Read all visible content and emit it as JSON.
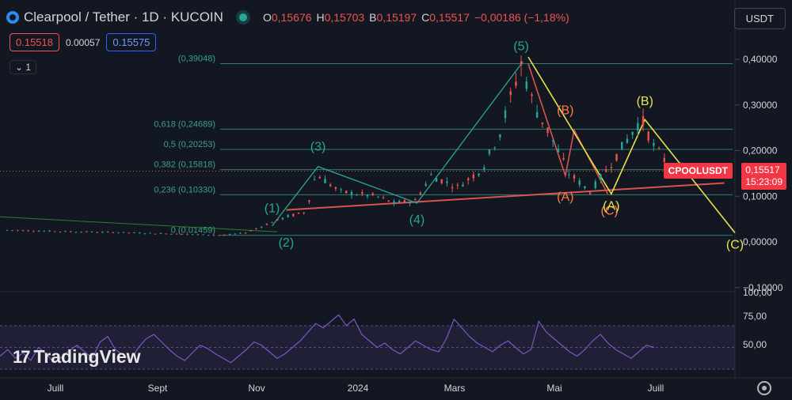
{
  "header": {
    "symbol": "Clearpool / Tether · 1D · KUCOIN",
    "ohlc": [
      {
        "k": "O",
        "v": "0,15676"
      },
      {
        "k": "H",
        "v": "0,15703"
      },
      {
        "k": "B",
        "v": "0,15197"
      },
      {
        "k": "C",
        "v": "0,15517"
      },
      {
        "k": "",
        "v": "−0,00186 (−1,18%)"
      }
    ],
    "sell_price": "0.15518",
    "spread": "0.00057",
    "buy_price": "0.15575",
    "collapse_label": "1",
    "currency": "USDT"
  },
  "watermark": "TradingView",
  "last_price": {
    "symbol": "CPOOLUSDT",
    "price": "0,15517",
    "countdown": "15:23:09"
  },
  "colors": {
    "up": "#26a69a",
    "down": "#ef5350",
    "teal": "#26a69a",
    "orange": "#ff7a45",
    "yellow": "#e8e34a",
    "rsi": "#7e57c2"
  },
  "chart_data": {
    "type": "candlestick",
    "x_ticks": [
      "Juill",
      "Sept",
      "Nov",
      "2024",
      "Mars",
      "Mai",
      "Juill"
    ],
    "y_ticks": [
      "0,40000",
      "0,30000",
      "0,20000",
      "0,10000",
      "0,00000",
      "−0,10000"
    ],
    "ylim": [
      -0.1,
      0.42
    ],
    "price_path": [
      [
        "2023-06-15",
        0.026
      ],
      [
        "2023-07-15",
        0.023
      ],
      [
        "2023-08-15",
        0.021
      ],
      [
        "2023-09-15",
        0.018
      ],
      [
        "2023-10-15",
        0.0146
      ],
      [
        "2023-10-28",
        0.02
      ],
      [
        "2023-11-10",
        0.04
      ],
      [
        "2023-11-20",
        0.055
      ],
      [
        "2023-12-01",
        0.065
      ],
      [
        "2023-12-07",
        0.15
      ],
      [
        "2023-12-20",
        0.11
      ],
      [
        "2024-01-10",
        0.1
      ],
      [
        "2024-01-20",
        0.085
      ],
      [
        "2024-02-01",
        0.09
      ],
      [
        "2024-02-10",
        0.145
      ],
      [
        "2024-02-25",
        0.12
      ],
      [
        "2024-03-10",
        0.16
      ],
      [
        "2024-03-20",
        0.24
      ],
      [
        "2024-04-01",
        0.39
      ],
      [
        "2024-04-08",
        0.3
      ],
      [
        "2024-04-18",
        0.23
      ],
      [
        "2024-04-28",
        0.15
      ],
      [
        "2024-05-10",
        0.11
      ],
      [
        "2024-05-20",
        0.16
      ],
      [
        "2024-06-01",
        0.23
      ],
      [
        "2024-06-08",
        0.27
      ],
      [
        "2024-06-15",
        0.21
      ],
      [
        "2024-06-25",
        0.16
      ],
      [
        "2024-07-05",
        0.155
      ]
    ],
    "fib_levels": [
      {
        "ratio": "",
        "value": 0.39048,
        "label": "(0,39048)"
      },
      {
        "ratio": "0,618",
        "value": 0.24689,
        "label": "(0,24689)"
      },
      {
        "ratio": "0,5",
        "value": 0.20253,
        "label": "(0,20253)"
      },
      {
        "ratio": "0,382",
        "value": 0.15818,
        "label": "(0,15818)"
      },
      {
        "ratio": "0,236",
        "value": 0.1033,
        "label": "(0,10330)"
      },
      {
        "ratio": "0",
        "value": 0.01459,
        "label": "(0,01459)"
      }
    ],
    "wave_labels": [
      {
        "text": "(1)",
        "date": "2023-11-12",
        "y": 0.065,
        "color": "teal"
      },
      {
        "text": "(2)",
        "date": "2023-11-20",
        "y": -0.01,
        "color": "teal"
      },
      {
        "text": "(3)",
        "date": "2023-12-08",
        "y": 0.2,
        "color": "teal"
      },
      {
        "text": "(4)",
        "date": "2024-02-02",
        "y": 0.04,
        "color": "teal"
      },
      {
        "text": "(5)",
        "date": "2024-04-01",
        "y": 0.42,
        "color": "teal"
      },
      {
        "text": "(B)",
        "date": "2024-04-26",
        "y": 0.28,
        "color": "orange"
      },
      {
        "text": "(A)",
        "date": "2024-04-26",
        "y": 0.09,
        "color": "orange"
      },
      {
        "text": "(C)",
        "date": "2024-05-21",
        "y": 0.06,
        "color": "orange"
      },
      {
        "text": "(A)",
        "date": "2024-05-22",
        "y": 0.07,
        "color": "yellow"
      },
      {
        "text": "(B)",
        "date": "2024-06-10",
        "y": 0.3,
        "color": "yellow"
      },
      {
        "text": "(C)",
        "date": "2024-07-31",
        "y": -0.015,
        "color": "yellow"
      }
    ],
    "rsi": {
      "ticks": [
        "75,00",
        "50,00"
      ],
      "range": [
        25,
        90
      ],
      "values": [
        42,
        48,
        40,
        45,
        38,
        50,
        44,
        36,
        41,
        47,
        52,
        46,
        40,
        55,
        60,
        48,
        43,
        39,
        50,
        58,
        62,
        55,
        48,
        42,
        38,
        45,
        52,
        49,
        44,
        40,
        36,
        42,
        48,
        55,
        52,
        46,
        40,
        44,
        50,
        56,
        64,
        72,
        68,
        74,
        80,
        70,
        76,
        62,
        56,
        50,
        54,
        48,
        44,
        50,
        56,
        52,
        48,
        46,
        58,
        76,
        68,
        60,
        54,
        50,
        46,
        52,
        56,
        50,
        44,
        48,
        74,
        64,
        58,
        52,
        46,
        42,
        48,
        56,
        62,
        54,
        48,
        44,
        40,
        46,
        52,
        50
      ]
    }
  }
}
